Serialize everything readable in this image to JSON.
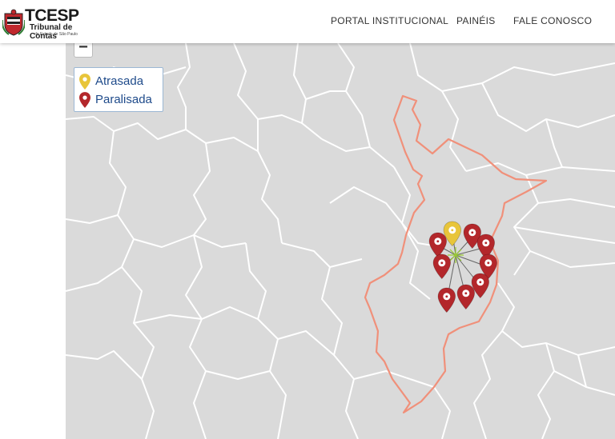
{
  "header": {
    "logo": {
      "title": "TCESP",
      "subtitle": "Tribunal de Contas",
      "small": "do Estado de São Paulo"
    },
    "nav": [
      "PORTAL INSTITUCIONAL",
      "PAINÉIS",
      "FALE CONOSCO"
    ]
  },
  "map": {
    "zoom_out_label": "−",
    "legend": [
      {
        "label": "Atrasada",
        "color": "#e8c53a",
        "icon": "map-pin-icon"
      },
      {
        "label": "Paralisada",
        "color": "#b3272b",
        "icon": "map-pin-icon"
      }
    ],
    "colors": {
      "background": "#dadada",
      "borders": "#ffffff",
      "region_outline": "#f0907a",
      "spider_lines": "#666666",
      "cluster_center": "#9acd32"
    },
    "markers": [
      {
        "status": "Atrasada"
      },
      {
        "status": "Paralisada"
      },
      {
        "status": "Paralisada"
      },
      {
        "status": "Paralisada"
      },
      {
        "status": "Paralisada"
      },
      {
        "status": "Paralisada"
      },
      {
        "status": "Paralisada"
      },
      {
        "status": "Paralisada"
      },
      {
        "status": "Paralisada"
      }
    ]
  }
}
